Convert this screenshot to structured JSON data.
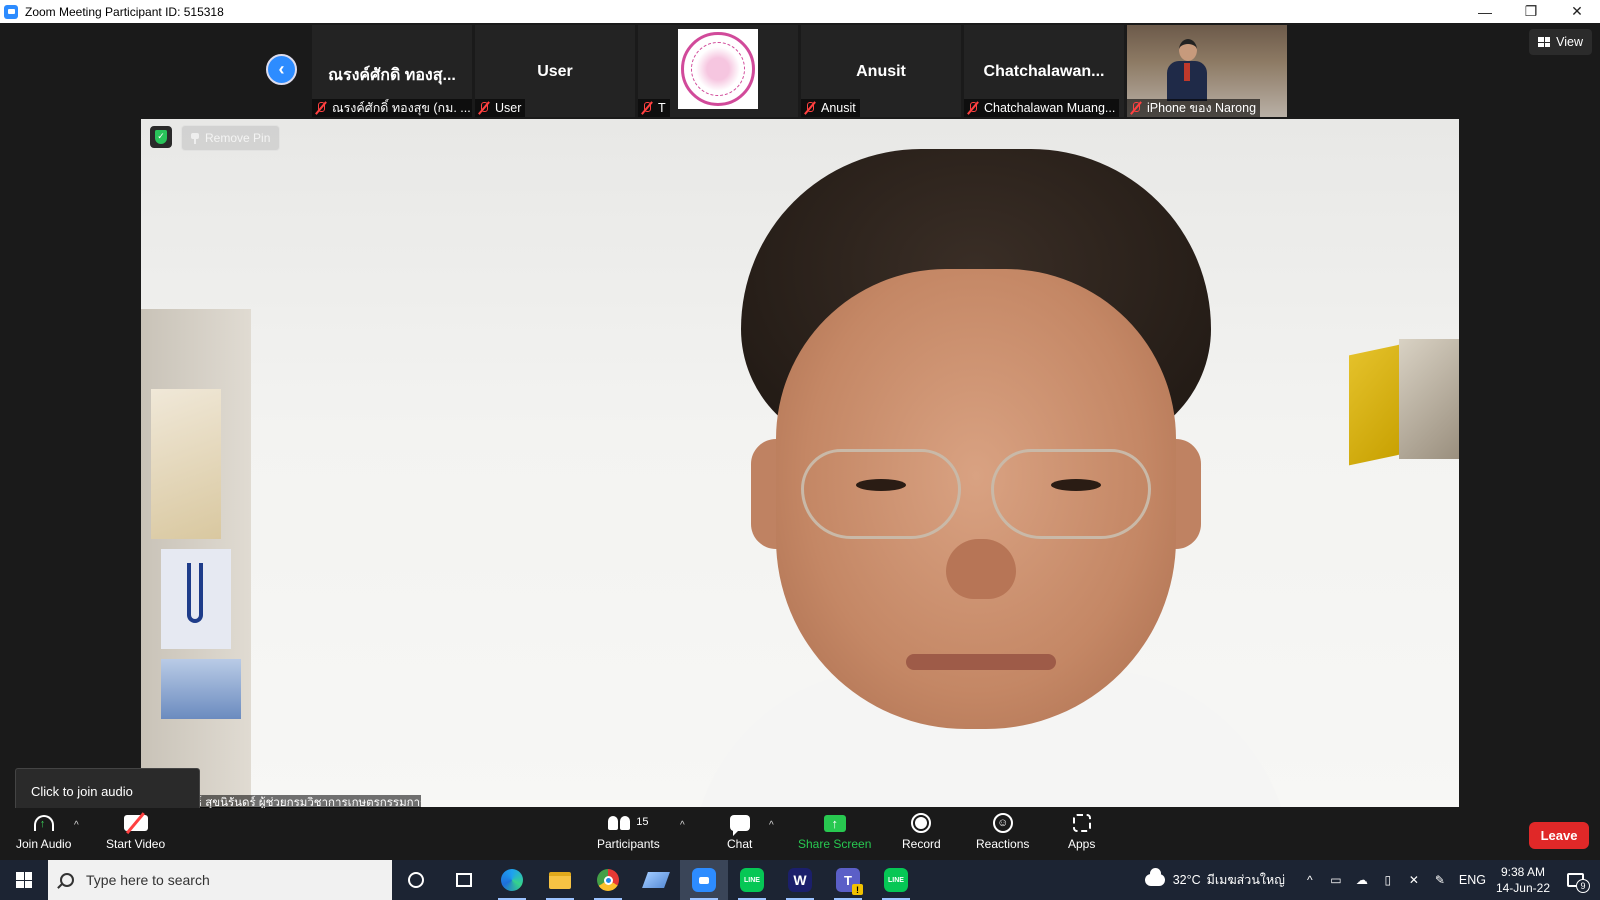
{
  "window": {
    "title": "Zoom Meeting Participant ID: 515318",
    "minimize": "—",
    "restore": "❐",
    "close": "✕"
  },
  "strip": {
    "prev_glyph": "‹",
    "tiles": [
      {
        "big_name": "ณรงค์ศักดิ  ทองสุ...",
        "label": "ณรงค์ศักดิ์ ทองสุข (กม. ..."
      },
      {
        "big_name": "User",
        "label": "User"
      },
      {
        "big_name": "",
        "label": "T"
      },
      {
        "big_name": "Anusit",
        "label": "Anusit"
      },
      {
        "big_name": "Chatchalawan...",
        "label": "Chatchalawan Muang..."
      },
      {
        "big_name": "",
        "label": "iPhone ของ Narong"
      }
    ],
    "view_label": "View"
  },
  "main": {
    "remove_pin": "Remove Pin",
    "shield_glyph": "✓",
    "speaker_label": "สัมพันธ์ สุขนิรันดร์ ผู้ช่วยกรมวิชาการเกษตรกรรมการกฤษฏีกา"
  },
  "tooltip": {
    "text": "Click to join audio"
  },
  "toolbar": {
    "join_audio": "Join Audio",
    "start_video": "Start Video",
    "participants": "Participants",
    "participants_count": "15",
    "chat": "Chat",
    "share_screen": "Share Screen",
    "share_glyph": "↑",
    "record": "Record",
    "reactions": "Reactions",
    "reactions_glyph": "☺",
    "apps": "Apps",
    "leave": "Leave",
    "caret": "^",
    "share_color": "#28c850",
    "leave_color": "#e02828"
  },
  "taskbar": {
    "search_placeholder": "Type here to search",
    "line_label": "LINE",
    "w_label": "W",
    "teams_label": "T",
    "temperature": "32°C",
    "weather_text": "มีเมฆส่วนใหญ่",
    "lang": "ENG",
    "time": "9:38 AM",
    "date": "14-Jun-22",
    "notifications": "9",
    "tray_up": "^",
    "tray_glyphs": [
      "▭",
      "☁",
      "▯",
      "✕",
      "✎"
    ]
  }
}
